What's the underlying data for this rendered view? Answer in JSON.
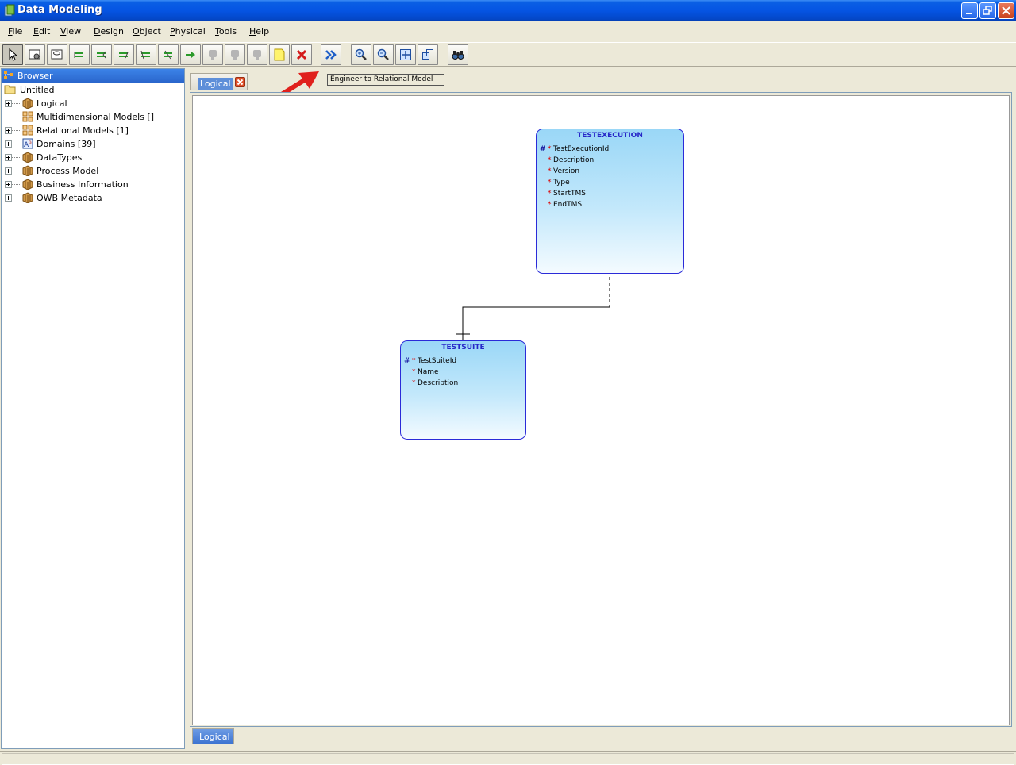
{
  "window": {
    "title": "Data Modeling"
  },
  "menu": [
    "File",
    "Edit",
    "View",
    "Design",
    "Object",
    "Physical",
    "Tools",
    "Help"
  ],
  "toolbar": {
    "buttons": [
      "select-tool",
      "new-entity",
      "new-view",
      "new-relation-1-1",
      "new-relation-1-n",
      "new-relation-m-n",
      "new-arc",
      "new-subtype",
      "new-flow",
      "disabled-1",
      "disabled-2",
      "disabled-3",
      "new-note",
      "delete",
      "engineer-to-relational",
      "zoom-in",
      "zoom-out",
      "fit-screen",
      "fit-to-view",
      "find"
    ],
    "tooltip": "Engineer to Relational Model"
  },
  "browser": {
    "title": "Browser",
    "root": "Untitled",
    "items": [
      {
        "label": "Logical",
        "icon": "package-icon",
        "expandable": true
      },
      {
        "label": "Multidimensional Models []",
        "icon": "grid-icon",
        "expandable": false
      },
      {
        "label": "Relational Models [1]",
        "icon": "grid-icon",
        "expandable": true
      },
      {
        "label": "Domains [39]",
        "icon": "domain-icon",
        "expandable": true
      },
      {
        "label": "DataTypes",
        "icon": "package-icon",
        "expandable": true
      },
      {
        "label": "Process Model",
        "icon": "package-icon",
        "expandable": true
      },
      {
        "label": "Business Information",
        "icon": "package-icon",
        "expandable": true
      },
      {
        "label": "OWB Metadata",
        "icon": "package-icon",
        "expandable": true
      }
    ]
  },
  "editor": {
    "tab_label": "Logical",
    "bottom_tab_label": "Logical"
  },
  "diagram": {
    "entities": [
      {
        "name": "TESTEXECUTION",
        "attributes": [
          {
            "pk": "#",
            "req": "*",
            "name": "TestExecutionId"
          },
          {
            "pk": "",
            "req": "*",
            "name": "Description"
          },
          {
            "pk": "",
            "req": "*",
            "name": "Version"
          },
          {
            "pk": "",
            "req": "*",
            "name": "Type"
          },
          {
            "pk": "",
            "req": "*",
            "name": "StartTMS"
          },
          {
            "pk": "",
            "req": "*",
            "name": "EndTMS"
          }
        ]
      },
      {
        "name": "TESTSUITE",
        "attributes": [
          {
            "pk": "#",
            "req": "*",
            "name": "TestSuiteId"
          },
          {
            "pk": "",
            "req": "*",
            "name": "Name"
          },
          {
            "pk": "",
            "req": "*",
            "name": "Description"
          }
        ]
      }
    ]
  },
  "colors": {
    "entity_border": "#2b2bd8",
    "entity_title": "#2727c8",
    "required_marker": "#dd0000",
    "arrow": "#e0201c"
  }
}
